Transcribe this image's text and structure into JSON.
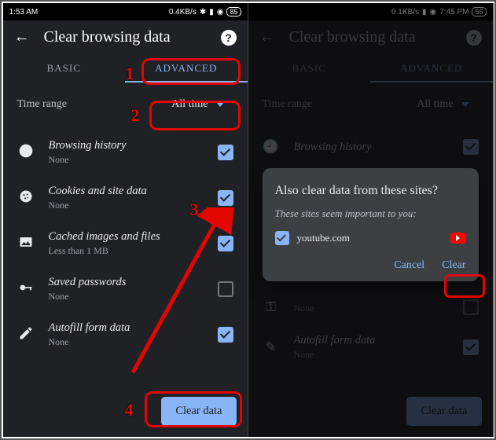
{
  "left": {
    "status": {
      "time": "1:53 AM",
      "net": "0.4KB/s",
      "batt": "85"
    },
    "title": "Clear browsing data",
    "tabs": {
      "basic": "BASIC",
      "advanced": "ADVANCED"
    },
    "timerange_label": "Time range",
    "timerange_value": "All time",
    "items": [
      {
        "label": "Browsing history",
        "sub": "None",
        "checked": true
      },
      {
        "label": "Cookies and site data",
        "sub": "None",
        "checked": true
      },
      {
        "label": "Cached images and files",
        "sub": "Less than 1 MB",
        "checked": true
      },
      {
        "label": "Saved passwords",
        "sub": "None",
        "checked": false
      },
      {
        "label": "Autofill form data",
        "sub": "None",
        "checked": true
      }
    ],
    "clear_button": "Clear data"
  },
  "right": {
    "status": {
      "time": "7:45 PM",
      "net": "0.1KB/s",
      "batt": "56"
    },
    "title": "Clear browsing data",
    "tabs": {
      "basic": "BASIC",
      "advanced": "ADVANCED"
    },
    "timerange_label": "Time range",
    "timerange_value": "All time",
    "items": [
      {
        "label": "Browsing history",
        "sub": "",
        "checked": true
      },
      {
        "label": "",
        "sub": "None",
        "checked": false
      },
      {
        "label": "Autofill form data",
        "sub": "None",
        "checked": true
      }
    ],
    "clear_button": "Clear data",
    "dialog": {
      "title": "Also clear data from these sites?",
      "sub": "These sites seem important to you:",
      "site": "youtube.com",
      "cancel": "Cancel",
      "clear": "Clear"
    }
  },
  "annotations": {
    "n1": "1",
    "n2": "2",
    "n3": "3",
    "n4": "4"
  }
}
